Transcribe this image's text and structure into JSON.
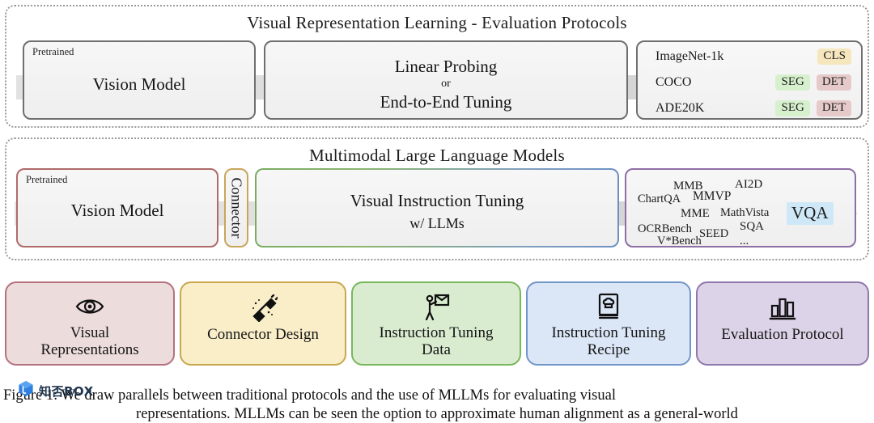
{
  "figure": {
    "panels": [
      {
        "id": "vrl",
        "title": "Visual Representation Learning - Evaluation Protocols",
        "vision_box": {
          "corner_tag": "Pretrained",
          "label": "Vision Model"
        },
        "protocol_box": {
          "line1": "Linear Probing",
          "line2": "or",
          "line3": "End-to-End Tuning"
        },
        "benchmarks": [
          {
            "name": "ImageNet-1k",
            "tags": [
              "CLS"
            ]
          },
          {
            "name": "COCO",
            "tags": [
              "SEG",
              "DET"
            ]
          },
          {
            "name": "ADE20K",
            "tags": [
              "SEG",
              "DET"
            ]
          }
        ]
      },
      {
        "id": "mllm",
        "title": "Multimodal Large Language Models",
        "vision_box": {
          "corner_tag": "Pretrained",
          "label": "Vision Model"
        },
        "connector_box": {
          "label": "Connector"
        },
        "tuning_box": {
          "line1": "Visual Instruction Tuning",
          "line2": "w/ LLMs"
        },
        "benchmark_cloud": [
          "MMB",
          "AI2D",
          "ChartQA",
          "MMVP",
          "MME",
          "MathVista",
          "OCRBench",
          "SEED",
          "SQA",
          "V*Bench",
          "..."
        ],
        "output_badge": "VQA"
      }
    ],
    "cards": [
      {
        "icon": "eye-icon",
        "line1": "Visual",
        "line2": "Representations",
        "fill": "#eddcdc",
        "border": "#b5717e"
      },
      {
        "icon": "connector-icon",
        "line1": "Connector Design",
        "line2": "",
        "fill": "#faeec9",
        "border": "#c9a74e"
      },
      {
        "icon": "teaching-icon",
        "line1": "Instruction Tuning",
        "line2": "Data",
        "fill": "#d9ecd0",
        "border": "#7ab65c"
      },
      {
        "icon": "cookbook-icon",
        "line1": "Instruction Tuning",
        "line2": "Recipe",
        "fill": "#dbe6f7",
        "border": "#7396c9"
      },
      {
        "icon": "barchart-icon",
        "line1": "Evaluation Protocol",
        "line2": "",
        "fill": "#ddd3e8",
        "border": "#8f78ab"
      }
    ],
    "tag_colors": {
      "CLS": "#f5e6bd",
      "SEG": "#d6f0cd",
      "DET": "#e6c9c9",
      "VQA": "#cfe8f7"
    }
  },
  "watermark": {
    "text": "知否BOX"
  },
  "caption": {
    "line1": "Figure 1: We draw parallels between traditional protocols and the use of MLLMs for evaluating visual",
    "line2": "representations. MLLMs can be seen  the option to approximate  human alignment  as  a  general-world"
  }
}
